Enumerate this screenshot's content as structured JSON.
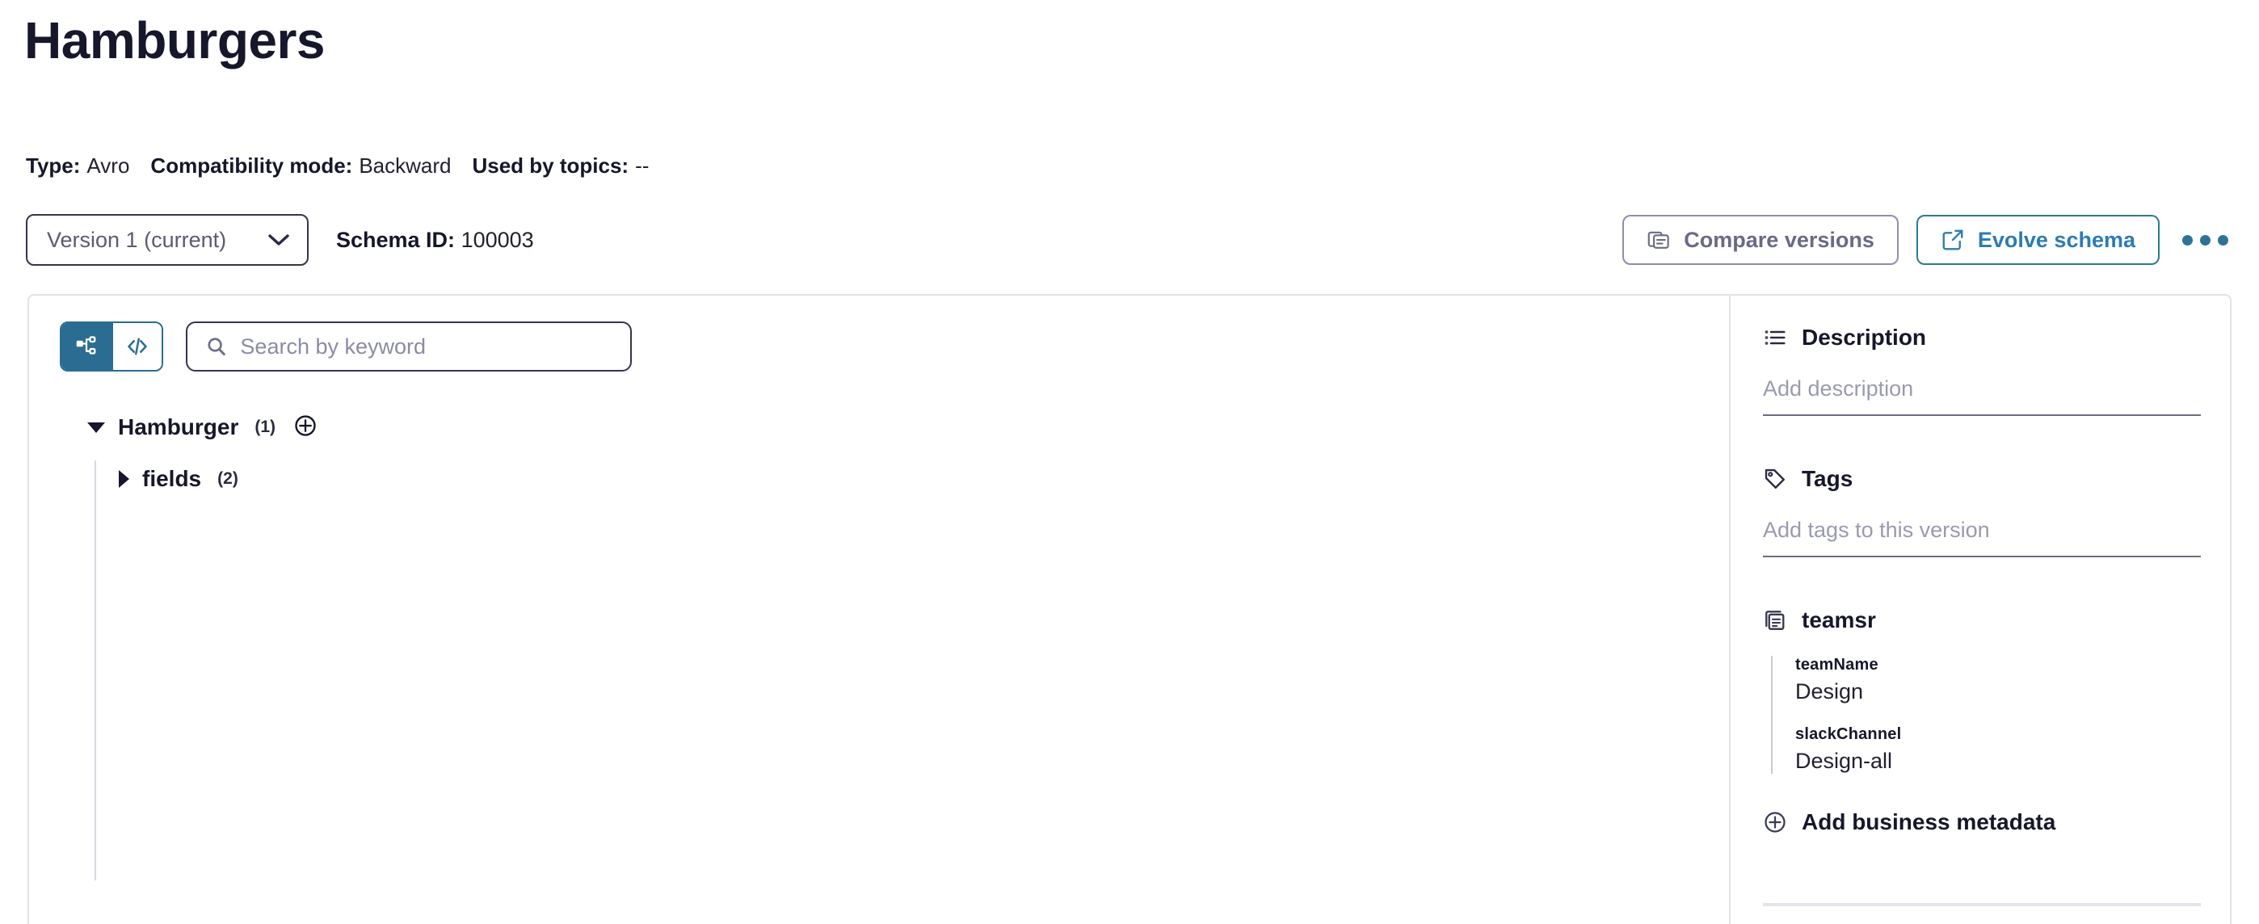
{
  "header": {
    "title": "Hamburgers",
    "meta": [
      {
        "label": "Type:",
        "value": "Avro"
      },
      {
        "label": "Compatibility mode:",
        "value": "Backward"
      },
      {
        "label": "Used by topics:",
        "value": "--"
      }
    ]
  },
  "toolbar": {
    "version_selected": "Version 1 (current)",
    "schema_id_label": "Schema ID:",
    "schema_id_value": "100003",
    "compare_label": "Compare versions",
    "evolve_label": "Evolve schema",
    "more_label": "More actions"
  },
  "viewer": {
    "toggle_tree_title": "Tree view",
    "toggle_code_title": "Code view",
    "search_placeholder": "Search by keyword",
    "search_value": "",
    "tree": {
      "root_name": "Hamburger",
      "root_count": "(1)",
      "child_name": "fields",
      "child_count": "(2)"
    }
  },
  "side": {
    "description_title": "Description",
    "description_placeholder": "Add description",
    "tags_title": "Tags",
    "tags_placeholder": "Add tags to this version",
    "business_metadata": {
      "group_title": "teamsr",
      "pairs": [
        {
          "key": "teamName",
          "value": "Design"
        },
        {
          "key": "slackChannel",
          "value": "Design-all"
        }
      ]
    },
    "add_business_metadata_label": "Add business metadata"
  },
  "colors": {
    "accent_teal": "#2b6c92",
    "link_blue": "#2d7cb3",
    "muted_slate": "#6a6a87",
    "text_dark": "#16172b",
    "border_light": "#e2e2e8"
  }
}
